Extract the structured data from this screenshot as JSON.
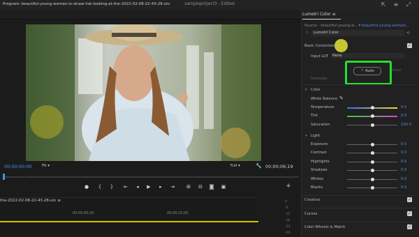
{
  "app": {
    "title": "sampleproject3",
    "status": "Edited"
  },
  "program": {
    "label": "Program: beautiful-young-woman-in-straw-hat-looking-at-the-2022-02-08-22-43-28-utc",
    "timecode_current": "00;00;00;00",
    "fit": "Fit",
    "resolution": "Full",
    "timecode_duration": "00;00;06;19"
  },
  "timeline": {
    "sequence_tab": "the-2022-02-08-22-43-28-utc",
    "ruler": [
      "00;00;05;00",
      "00;00;10;00"
    ],
    "meter_ticks": [
      "0",
      "-6",
      "-12",
      "-18",
      "-24",
      "-30"
    ]
  },
  "lumetri": {
    "tab": "Lumetri Color",
    "source_prefix": "Source · beautiful-young-w...",
    "source_link": "beautiful-young-woman...",
    "effect": "Lumetri Color",
    "basic_correction": "Basic Correction",
    "input_lut_label": "Input LUT",
    "input_lut_value": "None",
    "auto": "Auto",
    "reset": "Reset",
    "intensity": "Intensity",
    "color_section": "Color",
    "white_balance": "White Balance",
    "temperature": {
      "label": "Temperature",
      "value": "0.0",
      "level": 0.5
    },
    "tint": {
      "label": "Tint",
      "value": "0.0",
      "level": 0.5
    },
    "saturation": {
      "label": "Saturation",
      "value": "100.0",
      "level": 0.5
    },
    "light_section": "Light",
    "exposure": {
      "label": "Exposure",
      "value": "0.0",
      "level": 0.5
    },
    "contrast": {
      "label": "Contrast",
      "value": "0.0",
      "level": 0.5
    },
    "highlights": {
      "label": "Highlights",
      "value": "0.0",
      "level": 0.5
    },
    "shadows": {
      "label": "Shadows",
      "value": "0.0",
      "level": 0.5
    },
    "whites": {
      "label": "Whites",
      "value": "0.0",
      "level": 0.5
    },
    "blacks": {
      "label": "Blacks",
      "value": "0.0",
      "level": 0.5
    },
    "creative": "Creative",
    "curves": "Curves",
    "color_wheels": "Color Wheels & Match"
  },
  "colors": {
    "accent": "#4d8ef0",
    "highlight": "#22e02f",
    "marker": "#d8c400"
  }
}
